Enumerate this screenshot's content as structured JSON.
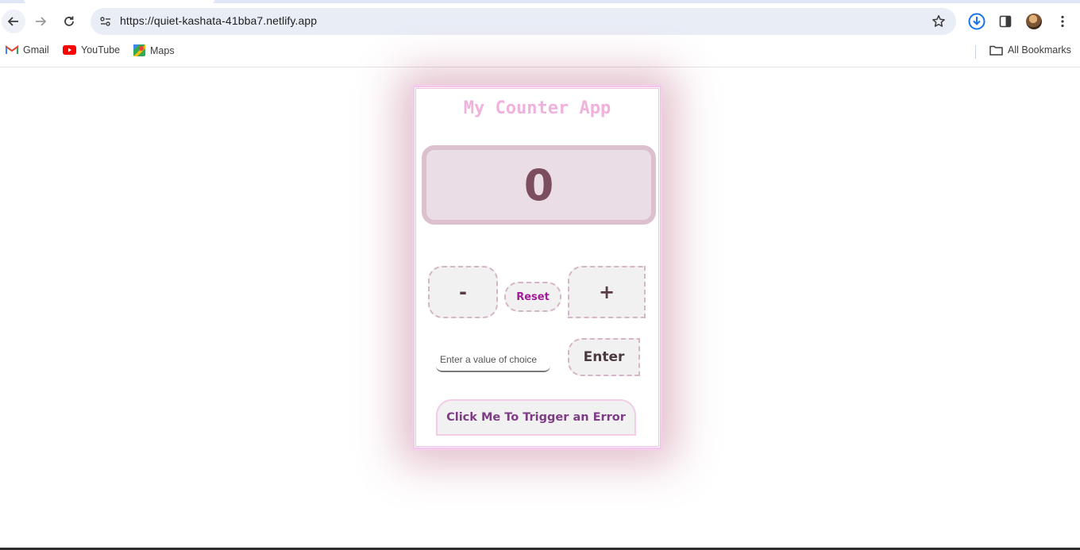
{
  "browser": {
    "url": "https://quiet-kashata-41bba7.netlify.app",
    "icons": {
      "back": "arrow-left-icon",
      "forward": "arrow-right-icon",
      "reload": "reload-icon",
      "site_info": "site-settings-icon",
      "star": "star-icon",
      "download": "download-icon",
      "side_panel": "side-panel-icon",
      "avatar": "profile-avatar",
      "menu": "kebab-menu-icon"
    },
    "accent_color": "#1a73e8"
  },
  "bookmarks": {
    "items": [
      {
        "label": "Gmail",
        "icon": "gmail-icon"
      },
      {
        "label": "YouTube",
        "icon": "youtube-icon"
      },
      {
        "label": "Maps",
        "icon": "maps-icon"
      }
    ],
    "all_bookmarks": {
      "label": "All Bookmarks",
      "icon": "folder-icon"
    }
  },
  "app": {
    "title": "My Counter App",
    "count": "0",
    "buttons": {
      "decrement": "-",
      "reset": "Reset",
      "increment": "+",
      "enter": "Enter",
      "error": "Click Me To Trigger an Error"
    },
    "input": {
      "placeholder": "Enter a value of choice",
      "value": ""
    },
    "colors": {
      "title": "#f0b2dc",
      "count_text": "#7b4d5f",
      "display_bg": "#eadde6",
      "reset_text": "#a3199a",
      "error_text": "#7f3c86",
      "card_border": "#f2bde9"
    }
  }
}
